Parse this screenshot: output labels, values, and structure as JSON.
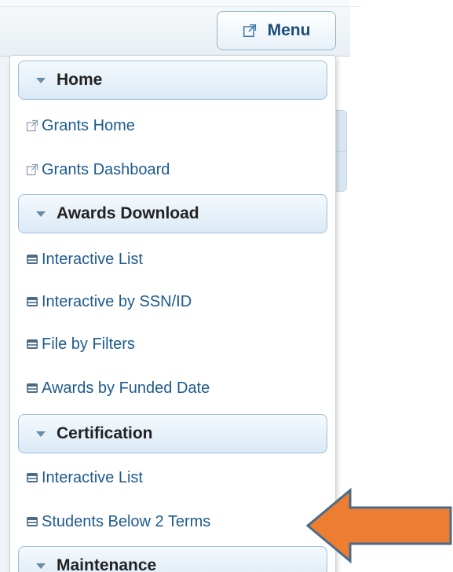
{
  "toolbar": {
    "menu_button_label": "Menu",
    "menu_button_icon": "external-link-icon"
  },
  "menu": {
    "sections": [
      {
        "label": "Home",
        "items": [
          {
            "label": "Grants Home",
            "icon": "external-link-icon"
          },
          {
            "label": "Grants Dashboard",
            "icon": "external-link-icon"
          }
        ]
      },
      {
        "label": "Awards Download",
        "items": [
          {
            "label": "Interactive List",
            "icon": "table-icon"
          },
          {
            "label": "Interactive by SSN/ID",
            "icon": "table-icon"
          },
          {
            "label": "File by Filters",
            "icon": "table-icon"
          },
          {
            "label": "Awards by Funded Date",
            "icon": "table-icon"
          }
        ]
      },
      {
        "label": "Certification",
        "items": [
          {
            "label": "Interactive List",
            "icon": "table-icon"
          },
          {
            "label": "Students Below 2 Terms",
            "icon": "table-icon"
          }
        ]
      },
      {
        "label": "Maintenance",
        "items": []
      }
    ]
  },
  "annotation": {
    "arrow_color": "#ED7D31",
    "arrow_outline": "#4A6B8A"
  },
  "colors": {
    "link_text": "#1D5A8E",
    "header_border": "#9CC0DE",
    "menu_button_text": "#1A4D7A"
  }
}
